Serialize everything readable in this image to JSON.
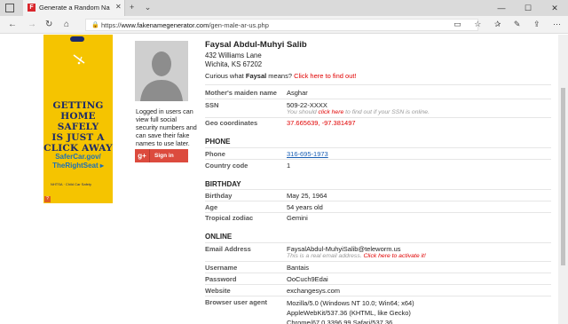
{
  "tab": {
    "title": "Generate a Random Na",
    "favicon_letter": "F",
    "close": "✕"
  },
  "tab_actions": {
    "new_tab": "+",
    "tab_list": "⌄"
  },
  "window_controls": {
    "minimize": "—",
    "maximize": "☐",
    "close": "✕"
  },
  "address_bar": {
    "host": "www.fakenamegenerator.com",
    "path": "/gen-male-ar-us.php",
    "protocol": "https://"
  },
  "ad": {
    "headline": [
      "GETTING",
      "HOME SAFELY",
      "IS JUST A",
      "CLICK AWAY"
    ],
    "link": [
      "SaferCar.gov/",
      "TheRightSeat ▸"
    ],
    "logos": "NHTSA  ·  Child Car Safety",
    "adchoice": "?"
  },
  "profile": {
    "name": "Faysal Abdul-Muhyi Salib",
    "street": "432 Williams Lane",
    "city": "Wichita, KS 67202",
    "curious_prefix": "Curious what ",
    "curious_name": "Faysal",
    "curious_mid": " means? ",
    "curious_link": "Click here to find out!"
  },
  "login": {
    "note": "Logged in users can view full social security numbers and can save their fake names to use later.",
    "signin_icon": "g+",
    "signin_label": "Sign in"
  },
  "identity": {
    "mothers_maiden_label": "Mother's maiden name",
    "mothers_maiden_value": "Asghar",
    "ssn_label": "SSN",
    "ssn_value": "509-22-XXXX",
    "ssn_note_prefix": "You should ",
    "ssn_note_link": "click here",
    "ssn_note_suffix": " to find out if your SSN is online.",
    "geo_label": "Geo coordinates",
    "geo_value": "37.665639, -97.381497"
  },
  "phone": {
    "heading": "PHONE",
    "phone_label": "Phone",
    "phone_value": "316-695-1973",
    "country_label": "Country code",
    "country_value": "1"
  },
  "birthday": {
    "heading": "BIRTHDAY",
    "birthday_label": "Birthday",
    "birthday_value": "May 25, 1964",
    "age_label": "Age",
    "age_value": "54 years old",
    "zodiac_label": "Tropical zodiac",
    "zodiac_value": "Gemini"
  },
  "online": {
    "heading": "ONLINE",
    "email_label": "Email Address",
    "email_value": "FaysalAbdul-MuhyiSalib@teleworm.us",
    "email_note_prefix": "This is a real email address. ",
    "email_note_link": "Click here to activate it!",
    "username_label": "Username",
    "username_value": "Bantais",
    "password_label": "Password",
    "password_value": "OoCuch9Edai",
    "website_label": "Website",
    "website_value": "exchangesys.com",
    "ua_label": "Browser user agent",
    "ua_value": "Mozilla/5.0 (Windows NT 10.0; Win64; x64) AppleWebKit/537.36 (KHTML, like Gecko) Chrome/67.0.3396.99 Safari/537.36"
  }
}
